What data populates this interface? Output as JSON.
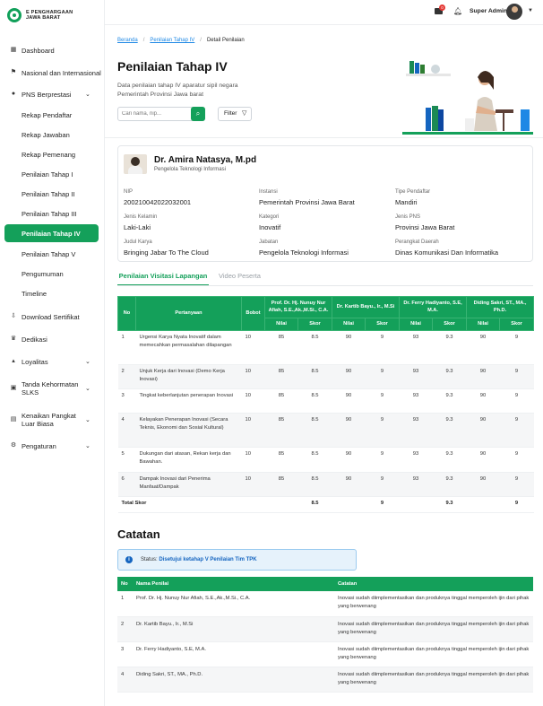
{
  "app": {
    "logo_line1": "E PENGHARGAAN",
    "logo_line2": "JAWA BARAT"
  },
  "topbar": {
    "notification_count": "0",
    "user_name": "Super Admin"
  },
  "sidebar": {
    "items": [
      {
        "label": "Dashboard",
        "icon": "dashboard-icon"
      },
      {
        "label": "Nasional dan Internasional",
        "icon": "flag-icon"
      },
      {
        "label": "PNS Berprestasi",
        "icon": "medal-icon",
        "expanded": true
      },
      {
        "label": "Rekap Pendaftar"
      },
      {
        "label": "Rekap Jawaban"
      },
      {
        "label": "Rekap Pemenang"
      },
      {
        "label": "Penilaian Tahap I"
      },
      {
        "label": "Penilaian Tahap II"
      },
      {
        "label": "Penilaian Tahap III"
      },
      {
        "label": "Penilaian Tahap IV",
        "active": true
      },
      {
        "label": "Penilaian Tahap V"
      },
      {
        "label": "Pengumuman"
      },
      {
        "label": "Timeline"
      },
      {
        "label": "Download Sertifikat",
        "icon": "download-icon"
      },
      {
        "label": "Dedikasi",
        "icon": "crown-icon"
      },
      {
        "label": "Loyalitas",
        "icon": "chart-icon"
      },
      {
        "label": "Tanda Kehormatan SLKS",
        "icon": "badge-icon"
      },
      {
        "label": "Kenaikan Pangkat Luar Biasa",
        "icon": "rank-icon"
      },
      {
        "label": "Pengaturan",
        "icon": "settings-icon"
      }
    ]
  },
  "breadcrumb": {
    "home": "Beranda",
    "parent": "Penilaian Tahap IV",
    "current": "Detail Penilaian"
  },
  "page": {
    "title": "Penilaian Tahap IV",
    "description": "Data penilaian tahap IV aparatur sipil negara Pemerintah Provinsi Jawa barat",
    "search_placeholder": "Cari nama, nip...",
    "filter_label": "Filter"
  },
  "profile": {
    "name": "Dr. Amira Natasya, M.pd",
    "role": "Pengelola Teknologi Informasi",
    "fields": [
      {
        "label": "NIP",
        "value": "200210042022032001"
      },
      {
        "label": "Instansi",
        "value": "Pemerintah Provinsi Jawa Barat"
      },
      {
        "label": "Tipe Pendaftar",
        "value": "Mandiri"
      },
      {
        "label": "Jenis Kelamin",
        "value": "Laki-Laki"
      },
      {
        "label": "Kategori",
        "value": "Inovatif"
      },
      {
        "label": "Jenis PNS",
        "value": "Provinsi Jawa Barat"
      },
      {
        "label": "Judul Karya",
        "value": "Bringing Jabar To The Cloud"
      },
      {
        "label": "Jabatan",
        "value": "Pengelola Teknologi Informasi"
      },
      {
        "label": "Perangkat Daerah",
        "value": "Dinas Komunikasi Dan Informatika"
      }
    ]
  },
  "tabs": {
    "visitasi": "Penilaian Visitasi Lapangan",
    "video": "Video Peserta"
  },
  "score_table": {
    "headers": {
      "no": "No",
      "question": "Pertanyaan",
      "weight": "Bobot",
      "nilai": "Nilai",
      "skor": "Skor"
    },
    "judges": [
      "Prof. Dr. Hj. Nunuy Nur Afiah, S.E.,Ak.,M.Si., C.A.",
      "Dr. Kartib Bayu., Ir., M.Si",
      "Dr. Ferry Hadiyanto, S.E, M.A.",
      "Diding Sakri, ST., MA., Ph.D."
    ],
    "rows": [
      {
        "no": "1",
        "question": "Urgensi Karya Nyata Inovatif dalam memecahkan permasalahan dilapangan",
        "weight": "10",
        "j1n": "85",
        "j1s": "8.5",
        "j2n": "90",
        "j2s": "9",
        "j3n": "93",
        "j3s": "9.3",
        "j4n": "90",
        "j4s": "9"
      },
      {
        "no": "2",
        "question": "Unjuk Kerja dari Inovasi (Demo Kerja Inovasi)",
        "weight": "10",
        "j1n": "85",
        "j1s": "8.5",
        "j2n": "90",
        "j2s": "9",
        "j3n": "93",
        "j3s": "9.3",
        "j4n": "90",
        "j4s": "9"
      },
      {
        "no": "3",
        "question": "Tingkat keberlanjutan penerapan Inovasi",
        "weight": "10",
        "j1n": "85",
        "j1s": "8.5",
        "j2n": "90",
        "j2s": "9",
        "j3n": "93",
        "j3s": "9.3",
        "j4n": "90",
        "j4s": "9"
      },
      {
        "no": "4",
        "question": "Kelayakan Penerapan Inovasi (Secara Teknis, Ekonomi dan Sosial Kultural)",
        "weight": "10",
        "j1n": "85",
        "j1s": "8.5",
        "j2n": "90",
        "j2s": "9",
        "j3n": "93",
        "j3s": "9.3",
        "j4n": "90",
        "j4s": "9"
      },
      {
        "no": "5",
        "question": "Dukungan dari atasan, Rekan kerja dan Bawahan.",
        "weight": "10",
        "j1n": "85",
        "j1s": "8.5",
        "j2n": "90",
        "j2s": "9",
        "j3n": "93",
        "j3s": "9.3",
        "j4n": "90",
        "j4s": "9"
      },
      {
        "no": "6",
        "question": "Dampak Inovasi dari Penerima Manfaat/Dampak",
        "weight": "10",
        "j1n": "85",
        "j1s": "8.5",
        "j2n": "90",
        "j2s": "9",
        "j3n": "93",
        "j3s": "9.3",
        "j4n": "90",
        "j4s": "9"
      }
    ],
    "total": {
      "label": "Total Skor",
      "j1": "8.5",
      "j2": "9",
      "j3": "9.3",
      "j4": "9"
    }
  },
  "notes": {
    "title": "Catatan",
    "status_label": "Status:",
    "status_value": "Disetujui ketahap V Penilaian Tim TPK",
    "headers": {
      "no": "No",
      "name": "Nama Penilai",
      "note": "Catatan"
    },
    "rows": [
      {
        "no": "1",
        "name": "Prof. Dr. Hj. Nunuy Nur Afiah, S.E.,Ak.,M.Si., C.A.",
        "note": "Inovasi sudah diimplementasikan dan produknya tinggal memperoleh ijin dari pihak yang berwenang"
      },
      {
        "no": "2",
        "name": "Dr. Kartib Bayu., Ir., M.Si",
        "note": "Inovasi sudah diimplementasikan dan produknya tinggal memperoleh ijin dari pihak yang berwenang"
      },
      {
        "no": "3",
        "name": "Dr. Ferry Hadiyanto, S.E, M.A.",
        "note": "Inovasi sudah diimplementasikan dan produknya tinggal memperoleh ijin dari pihak yang berwenang"
      },
      {
        "no": "4",
        "name": "Diding Sakri, ST., MA., Ph.D.",
        "note": "Inovasi sudah diimplementasikan dan produknya tinggal memperoleh ijin dari pihak yang berwenang"
      }
    ]
  },
  "colors": {
    "primary": "#14a05a",
    "link": "#1e88e5",
    "info": "#1565c0"
  }
}
